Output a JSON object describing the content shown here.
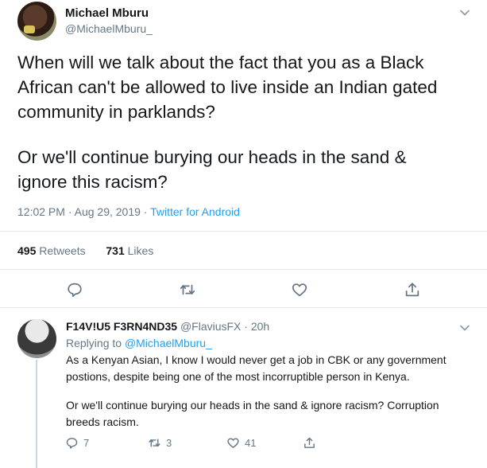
{
  "tweet": {
    "author_name": "Michael Mburu",
    "author_handle": "@MichaelMburu_",
    "lines": [
      "When will we talk about the fact that you as a Black",
      "African can't be allowed to live inside an Indian gated",
      "community in parklands?",
      "Or we'll continue burying our heads in the sand &",
      "ignore this racism?"
    ],
    "time": "12:02 PM",
    "date": "Aug 29, 2019",
    "source": "Twitter for Android",
    "retweets_count": "495",
    "retweets_label": "Retweets",
    "likes_count": "731",
    "likes_label": "Likes"
  },
  "reply": {
    "author_name": "F14V!U5 F3RN4ND35",
    "author_handle": "@FlaviusFX",
    "time_ago": "20h",
    "replying_prefix": "Replying to",
    "replying_to": "@MichaelMburu_",
    "lines": [
      "As a Kenyan Asian, I know I would never get a job in CBK or any government",
      "postions, despite being one of the most incorruptible person in Kenya.",
      "Or we'll continue burying our heads in the sand & ignore racism? Corruption",
      "breeds racism."
    ],
    "reply_count": "7",
    "retweet_count": "3",
    "like_count": "41"
  },
  "colors": {
    "accent": "#1da1f2",
    "secondary_text": "#657786",
    "divider": "#e6ecf0"
  },
  "icons": [
    "chevron-down-icon",
    "reply-icon",
    "retweet-icon",
    "like-icon",
    "share-icon"
  ]
}
